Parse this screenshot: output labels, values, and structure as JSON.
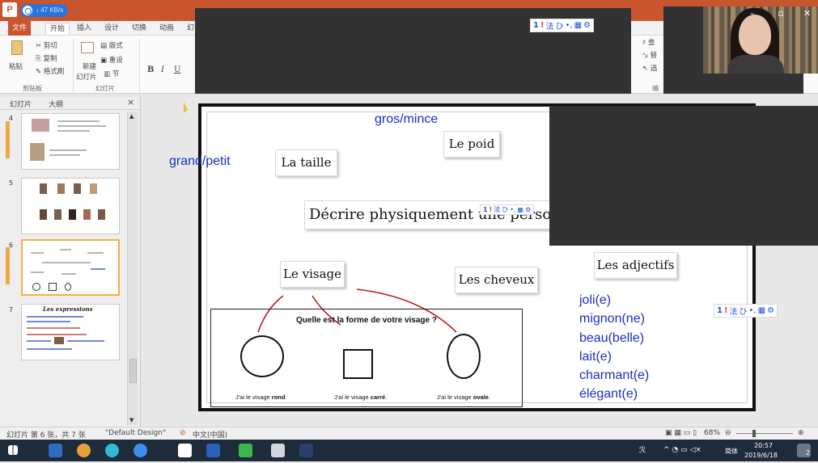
{
  "app": {
    "badge": "P",
    "net_speed": "↓ 47 KB/s"
  },
  "ribbon_tabs": [
    "文件",
    "开始",
    "插入",
    "设计",
    "切换",
    "动画",
    "幻"
  ],
  "ribbon": {
    "paste": "粘贴",
    "cut": "剪切",
    "copy": "复制",
    "format_painter": "格式刷",
    "clipboard_group": "剪贴板",
    "new_slide": "新建",
    "new_slide_sub": "幻灯片",
    "layout": "版式",
    "reset": "重设",
    "section": "节",
    "slides_group": "幻灯片",
    "bold": "B",
    "italic": "I",
    "underline": "U",
    "right_find": "查",
    "right_replace": "替",
    "right_select": "选",
    "right_group": "编"
  },
  "left_pane": {
    "tab_slides": "幻灯片",
    "tab_outline": "大纲",
    "close": "×",
    "thumbnails": [
      {
        "number": "4"
      },
      {
        "number": "5"
      },
      {
        "number": "6"
      },
      {
        "number": "7",
        "title": "Les expressions"
      }
    ]
  },
  "slide": {
    "gros_mince": "gros/mince",
    "grand_petit": "grand/petit",
    "la_taille": "La taille",
    "le_poid": "Le poid",
    "title": "Décrire physiquement une person",
    "le_visage": "Le visage",
    "les_cheveux": "Les cheveux",
    "les_adjectifs": "Les adjectifs",
    "adjectives": [
      "joli(e)",
      "mignon(ne)",
      "beau(belle)",
      "lait(e)",
      "charmant(e)",
      "élégant(e)"
    ],
    "face_question": "Quelle est la forme de votre visage ?",
    "captions": [
      {
        "prefix": "J'ai le visage ",
        "bold": "rond",
        "suffix": "."
      },
      {
        "prefix": "J'ai le visage ",
        "bold": "carré",
        "suffix": "."
      },
      {
        "prefix": "J'ai le visage ",
        "bold": "ovale",
        "suffix": "."
      }
    ]
  },
  "ime_toolbar": {
    "a": "1",
    "b": "!",
    "c": "法",
    "d": "ひ",
    "e": "•,",
    "f": "▦",
    "g": "⚙"
  },
  "status": {
    "slide_count": "幻灯片 第 6 张，共 7 张",
    "theme": "\"Default Design\"",
    "language": "中文(中国)",
    "zoom": "68%"
  },
  "taskbar": {
    "ime_lang": "简体",
    "time": "20:57",
    "date": "2019/6/18",
    "notification_count": "2"
  },
  "colors": {
    "accent": "#c9552e",
    "slide_blue_text": "#1a2fbf",
    "taskbar": "#1d2b3a"
  }
}
